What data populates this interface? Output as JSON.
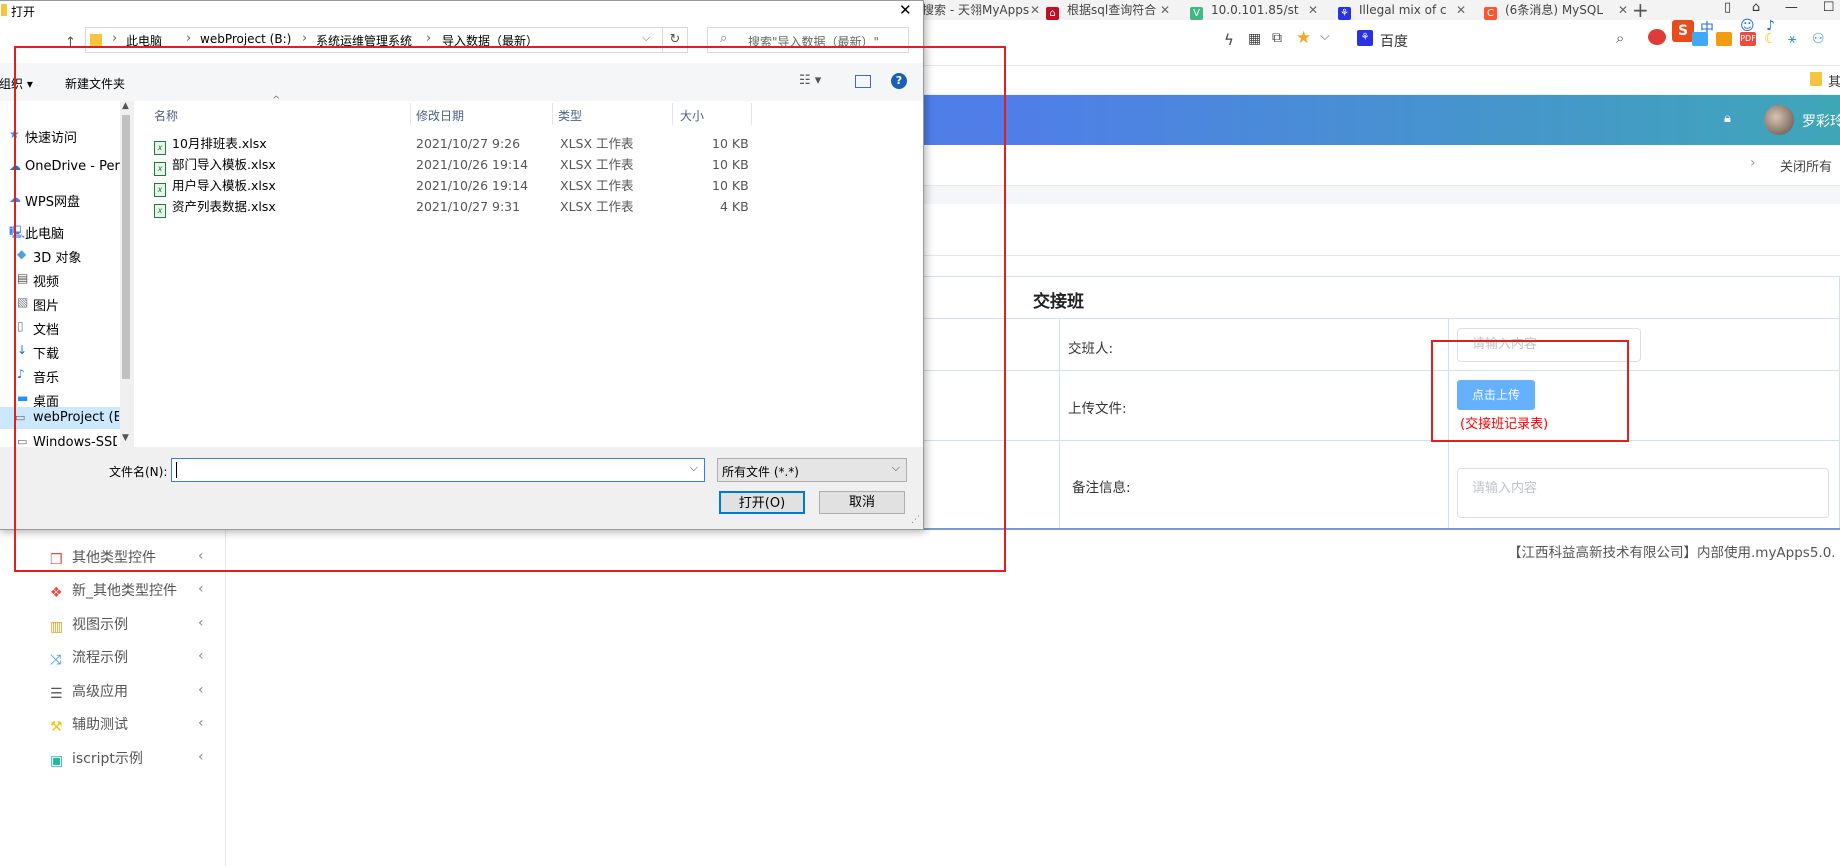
{
  "browser": {
    "tabs": [
      {
        "title": "搜索 - 天翎MyApps",
        "icon_color": "#1677ff"
      },
      {
        "title": "根据sql查询符合",
        "icon_color": "#c30d23"
      },
      {
        "title": "10.0.101.85/st",
        "icon_color": "#41b883"
      },
      {
        "title": "Illegal mix of c",
        "icon_color": "#2932e1"
      },
      {
        "title": "(6条消息) MySQL",
        "icon_color": "#fc5531"
      }
    ],
    "new_tab_label": "+",
    "search_engine_label": "百度",
    "ime_label": "中",
    "bookmark_label": "其"
  },
  "app": {
    "user_name": "罗彩玲",
    "close_all_label": "关闭所有",
    "sidebar": {
      "items": [
        {
          "label": "其他类型控件",
          "icon": "cube-icon",
          "color": "#e74c3c"
        },
        {
          "label": "新_其他类型控件",
          "icon": "cubes-icon",
          "color": "#e74c3c"
        },
        {
          "label": "视图示例",
          "icon": "columns-icon",
          "color": "#f39c12"
        },
        {
          "label": "流程示例",
          "icon": "shuffle-icon",
          "color": "#3498db"
        },
        {
          "label": "高级应用",
          "icon": "list-icon",
          "color": "#555555"
        },
        {
          "label": "辅助测试",
          "icon": "hammer-icon",
          "color": "#f1c40f"
        },
        {
          "label": "iscript示例",
          "icon": "script-icon",
          "color": "#1abc9c"
        }
      ]
    },
    "form": {
      "title": "交接班",
      "rows": [
        {
          "label": "交班人:",
          "placeholder": "请输入内容"
        },
        {
          "label": "上传文件:",
          "button": "点击上传",
          "hint": "(交接班记录表)"
        },
        {
          "label": "备注信息:",
          "placeholder": "请输入内容"
        }
      ]
    },
    "footer": "【江西科益高新技术有限公司】内部使用.myApps5.0."
  },
  "dialog": {
    "title": "打开",
    "close_glyph": "✕",
    "breadcrumb": [
      "此电脑",
      "webProject (B:)",
      "系统运维管理系统",
      "导入数据（最新）"
    ],
    "search_placeholder": "搜索\"导入数据（最新）\"",
    "organize_label": "组织 ▾",
    "new_folder_label": "新建文件夹",
    "nav": [
      {
        "label": "快速访问",
        "icon": "star-icon",
        "color": "#1e90ff"
      },
      {
        "label": "OneDrive - Perso",
        "icon": "cloud-icon",
        "color": "#1e6fd9"
      },
      {
        "label": "WPS网盘",
        "icon": "cloud-icon",
        "color": "#3b82f6"
      },
      {
        "label": "此电脑",
        "icon": "computer-icon",
        "color": "#3b82f6"
      },
      {
        "label": "3D 对象",
        "icon": "cube-icon",
        "color": "#4aa3df"
      },
      {
        "label": "视频",
        "icon": "film-icon",
        "color": "#555555"
      },
      {
        "label": "图片",
        "icon": "image-icon",
        "color": "#6b7b8c"
      },
      {
        "label": "文档",
        "icon": "document-icon",
        "color": "#6b7b8c"
      },
      {
        "label": "下载",
        "icon": "download-icon",
        "color": "#1e6fd9"
      },
      {
        "label": "音乐",
        "icon": "music-icon",
        "color": "#1e6fd9"
      },
      {
        "label": "桌面",
        "icon": "desktop-icon",
        "color": "#1e90ff"
      },
      {
        "label": "webProject (B:)",
        "icon": "drive-icon",
        "color": "#666666"
      },
      {
        "label": "Windows-SSD",
        "icon": "drive-icon",
        "color": "#666666"
      }
    ],
    "columns": [
      "名称",
      "修改日期",
      "类型",
      "大小"
    ],
    "files": [
      {
        "name": "10月排班表.xlsx",
        "date": "2021/10/27 9:26",
        "type": "XLSX 工作表",
        "size": "10 KB"
      },
      {
        "name": "部门导入模板.xlsx",
        "date": "2021/10/26 19:14",
        "type": "XLSX 工作表",
        "size": "10 KB"
      },
      {
        "name": "用户导入模板.xlsx",
        "date": "2021/10/26 19:14",
        "type": "XLSX 工作表",
        "size": "10 KB"
      },
      {
        "name": "资产列表数据.xlsx",
        "date": "2021/10/27 9:31",
        "type": "XLSX 工作表",
        "size": "4 KB"
      }
    ],
    "filename_label": "文件名(N):",
    "filename_value": "",
    "filetype_value": "所有文件 (*.*)",
    "open_label": "打开(O)",
    "cancel_label": "取消",
    "help_glyph": "?"
  }
}
